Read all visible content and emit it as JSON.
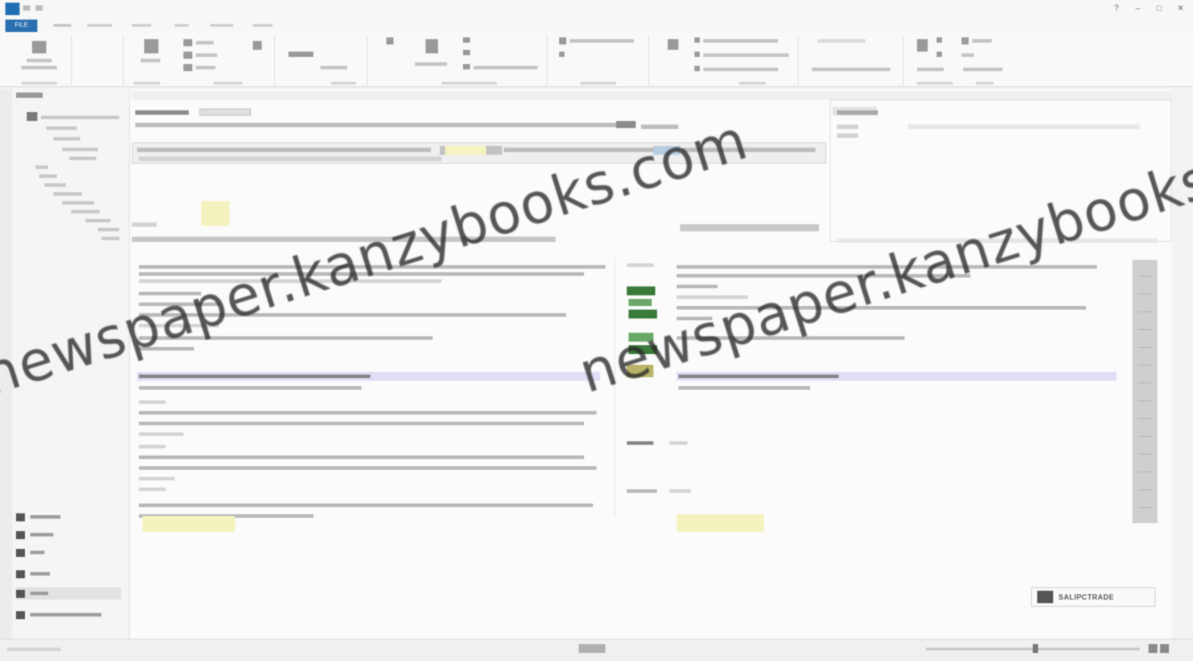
{
  "window": {
    "controls": [
      "?",
      "–",
      "□",
      "✕"
    ]
  },
  "ribbon": {
    "file_tab": "FILE"
  },
  "watermark": {
    "text_left": "newspaper.kanzybooks.com",
    "text_right": "newspaper.kanzybooks.com"
  },
  "brand": {
    "label": "SALIPCTRADE"
  },
  "colors": {
    "accent": "#2a6fb0",
    "highlight_yellow": "#f4f3bf",
    "status_green": "#3a7a3a",
    "selection_violet": "#e0def7"
  }
}
